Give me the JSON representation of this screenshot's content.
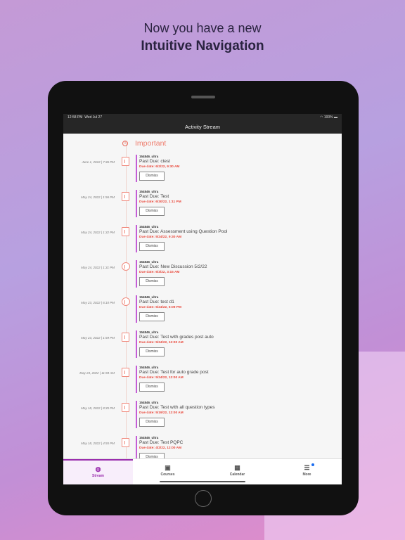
{
  "headline": {
    "line1": "Now you have a new",
    "line2": "Intuitive Navigation"
  },
  "status_bar": {
    "time": "12:58 PM",
    "date": "Wed Jul 27",
    "battery": "100%"
  },
  "header": {
    "title": "Activity Stream"
  },
  "section": {
    "title": "Important"
  },
  "dismiss_label": "Dismiss",
  "items": [
    {
      "date": "June 1, 2022 | 7:36 PM",
      "course": "154846_ultra",
      "title": "Past Due: ctest",
      "due": "Due date: 6/2/22, 9:30 AM",
      "icon": "test-document-icon"
    },
    {
      "date": "May 24, 2022 | 1:56 PM",
      "course": "154846_ultra",
      "title": "Past Due: Test",
      "due": "Due date: 6/30/22, 1:11 PM",
      "icon": "test-document-icon"
    },
    {
      "date": "May 24, 2022 | 1:32 PM",
      "course": "154846_ultra",
      "title": "Past Due: Assessment using Question Pool",
      "due": "Due date: 5/24/22, 9:30 AM",
      "icon": "test-document-icon"
    },
    {
      "date": "May 24, 2022 | 1:31 PM",
      "course": "154846_ultra",
      "title": "Past Due: New Discussion 5/2/22",
      "due": "Due date: 6/3/22, 3:15 AM",
      "icon": "discussion-icon"
    },
    {
      "date": "May 23, 2022 | 6:10 PM",
      "course": "154846_ultra",
      "title": "Past Due: test d1",
      "due": "Due date: 5/24/22, 6:09 PM",
      "icon": "discussion-icon"
    },
    {
      "date": "May 23, 2022 | 1:59 PM",
      "course": "154846_ultra",
      "title": "Past Due: Test with grades post auto",
      "due": "Due date: 5/24/22, 12:00 AM",
      "icon": "test-document-icon"
    },
    {
      "date": "May 23, 2022 | 11:59 AM",
      "course": "154846_ultra",
      "title": "Past Due: Test for auto grade post",
      "due": "Due date: 5/24/22, 12:00 AM",
      "icon": "test-document-icon"
    },
    {
      "date": "May 18, 2022 | 8:35 PM",
      "course": "154846_ultra",
      "title": "Past Due: Test with all question types",
      "due": "Due date: 5/19/22, 12:00 AM",
      "icon": "test-document-icon"
    },
    {
      "date": "May 18, 2022 | 4:55 PM",
      "course": "154846_ultra",
      "title": "Past Due: Test PQPC",
      "due": "Due date: 4/2/22, 12:00 AM",
      "icon": "test-document-icon"
    }
  ],
  "tabs": [
    {
      "label": "Stream",
      "icon": "globe-icon",
      "active": true
    },
    {
      "label": "Courses",
      "icon": "courses-icon",
      "active": false
    },
    {
      "label": "Calendar",
      "icon": "calendar-icon",
      "active": false
    },
    {
      "label": "More",
      "icon": "menu-icon",
      "active": false,
      "badge": true
    }
  ],
  "colors": {
    "accent": "#9b2fae",
    "due": "#e9473a",
    "important": "#ee7b6b",
    "badge": "#1a6cf0"
  }
}
